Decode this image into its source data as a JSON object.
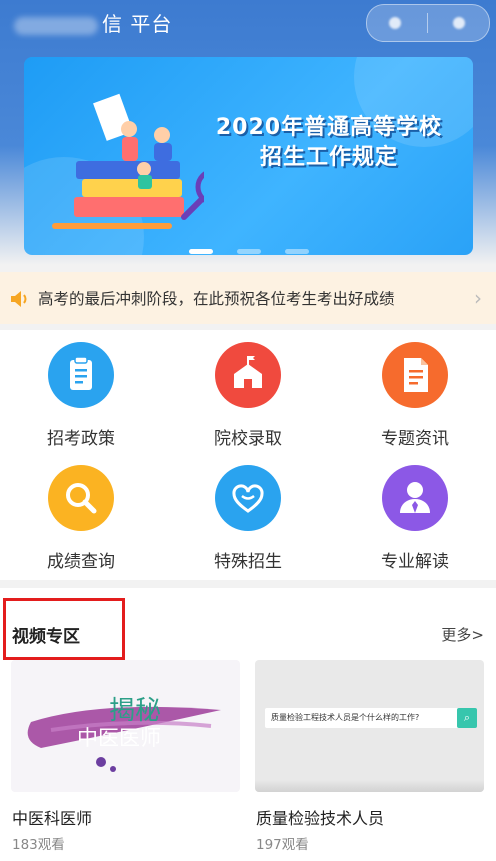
{
  "header": {
    "title": "信 平台"
  },
  "banner": {
    "title_line1": "2020年普通高等学校",
    "title_line2": "招生工作规定",
    "page_count": 3,
    "active_page": 1
  },
  "notice": {
    "text": "高考的最后冲刺阶段，在此预祝各位考生考出好成绩"
  },
  "grid": [
    {
      "label": "招考政策",
      "icon": "clipboard-icon",
      "color": "#2aa3ef"
    },
    {
      "label": "院校录取",
      "icon": "school-building-icon",
      "color": "#f04a3e"
    },
    {
      "label": "专题资讯",
      "icon": "document-icon",
      "color": "#f66b2d"
    },
    {
      "label": "成绩查询",
      "icon": "magnifier-icon",
      "color": "#fbb322"
    },
    {
      "label": "特殊招生",
      "icon": "heart-hand-icon",
      "color": "#2aa3ef"
    },
    {
      "label": "专业解读",
      "icon": "person-icon",
      "color": "#8c58e6"
    }
  ],
  "videos": {
    "section_title": "视频专区",
    "more_label": "更多>",
    "items": [
      {
        "title": "中医科医师",
        "views": "183观看",
        "thumb_text1": "揭秘",
        "thumb_text2": "中医医师"
      },
      {
        "title": "质量检验技术人员",
        "views": "197观看",
        "thumb_text1": "质量检验工程技术人员是个什么样的工作?"
      }
    ]
  }
}
